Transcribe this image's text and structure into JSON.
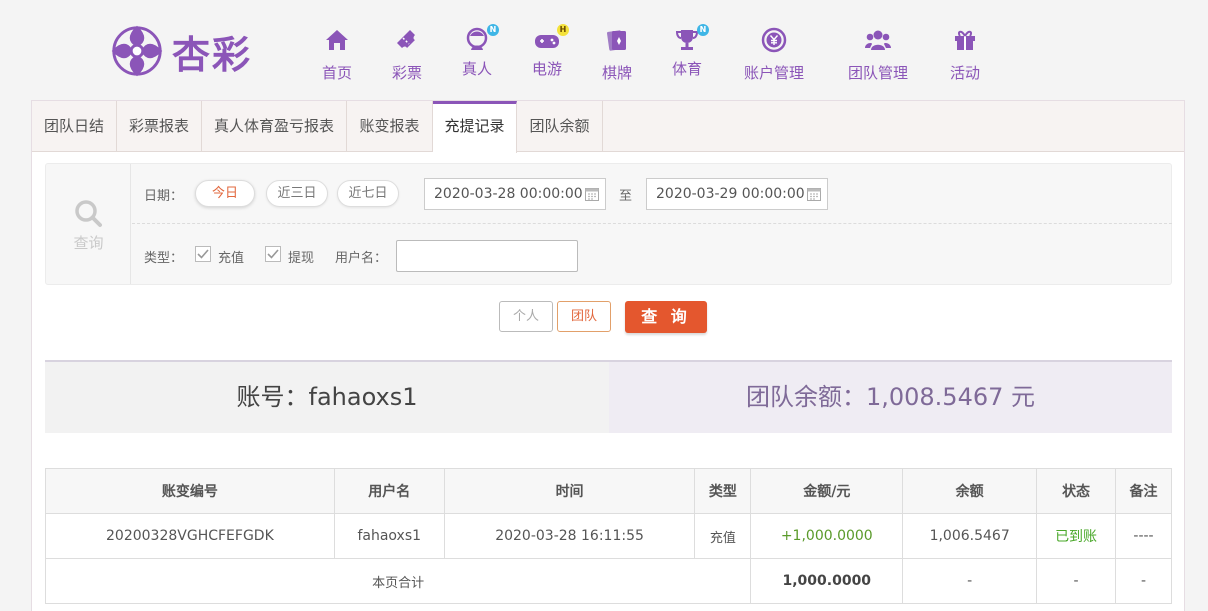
{
  "brand": {
    "logo_text": "杏彩",
    "color": "#8b55b8"
  },
  "nav": [
    {
      "label": "首页",
      "icon": "home-icon"
    },
    {
      "label": "彩票",
      "icon": "lottery-ticket-icon"
    },
    {
      "label": "真人",
      "icon": "live-dealer-icon",
      "badge": "N"
    },
    {
      "label": "电游",
      "icon": "gamepad-icon",
      "badge": "H"
    },
    {
      "label": "棋牌",
      "icon": "cards-icon"
    },
    {
      "label": "体育",
      "icon": "trophy-icon",
      "badge": "N"
    },
    {
      "label": "账户管理",
      "icon": "yen-coin-icon"
    },
    {
      "label": "团队管理",
      "icon": "team-icon"
    },
    {
      "label": "活动",
      "icon": "gift-icon"
    }
  ],
  "tabs": [
    "团队日结",
    "彩票报表",
    "真人体育盈亏报表",
    "账变报表",
    "充提记录",
    "团队余额"
  ],
  "active_tab": "充提记录",
  "filter": {
    "search_label": "查询",
    "date_label": "日期：",
    "quick_dates": [
      "今日",
      "近三日",
      "近七日"
    ],
    "start_date": "2020-03-28 00:00:00",
    "to_label": "至",
    "end_date": "2020-03-29 00:00:00",
    "type_label": "类型：",
    "type_deposit": "充值",
    "type_withdraw": "提现",
    "username_label": "用户名：",
    "username_value": ""
  },
  "buttons": {
    "personal": "个人",
    "team": "团队",
    "query": "查 询"
  },
  "summary": {
    "account": "账号：fahaoxs1",
    "team_balance": "团队余额：1,008.5467 元"
  },
  "table": {
    "headers": [
      "账变编号",
      "用户名",
      "时间",
      "类型",
      "金额/元",
      "余额",
      "状态",
      "备注"
    ],
    "rows": [
      [
        "20200328VGHCFEFGDK",
        "fahaoxs1",
        "2020-03-28 16:11:55",
        "充值",
        "+1,000.0000",
        "1,006.5467",
        "已到账",
        "----"
      ]
    ],
    "total": {
      "label": "本页合计",
      "amount": "1,000.0000",
      "balance": "-",
      "status": "-",
      "remark": "-"
    }
  }
}
